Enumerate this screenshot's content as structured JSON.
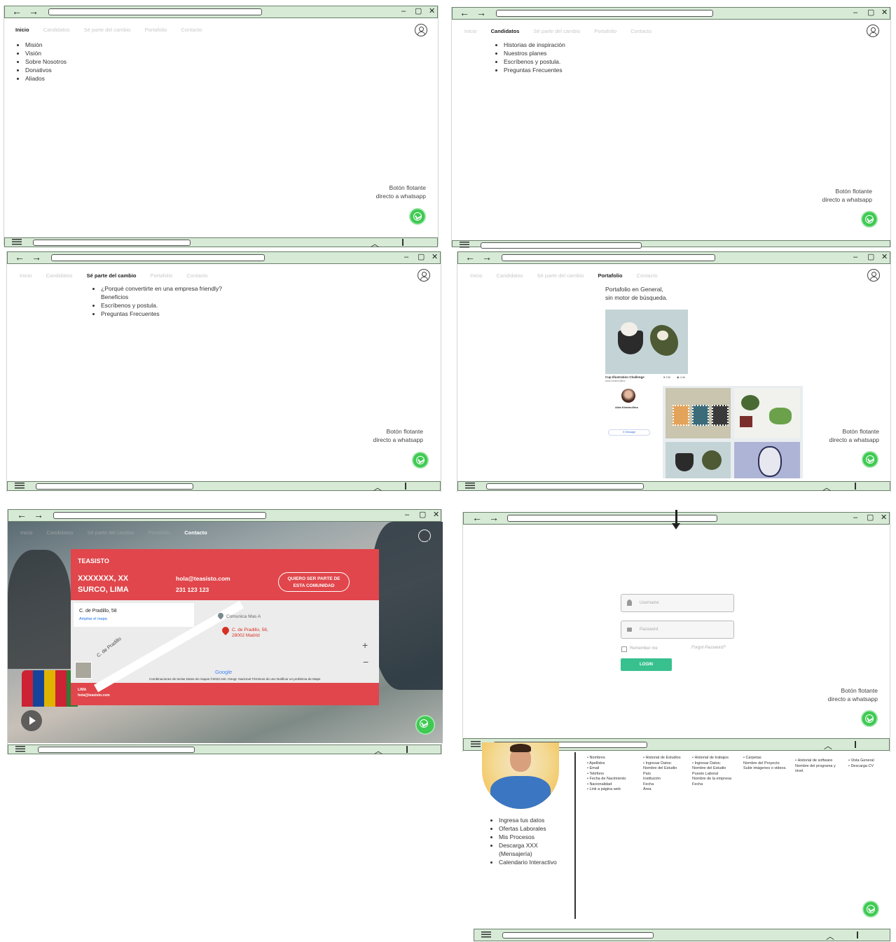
{
  "browser": {
    "back_icon": "←",
    "forward_icon": "→",
    "minimize_icon": "–",
    "maximize_icon": "▢",
    "close_icon": "✕",
    "up_icon": "︿"
  },
  "nav_items": [
    "Inicio",
    "Candidatos",
    "Sé parte del cambio",
    "Portafolio",
    "Contacto"
  ],
  "float_label_1": "Botón flotante",
  "float_label_2": "directo a whatsapp",
  "panel_inicio": {
    "items": [
      "Misión",
      "Visión",
      "Sobre Nosotros",
      "Donativos",
      "Aliados"
    ]
  },
  "panel_candidatos": {
    "items": [
      "Historias de inspiración",
      "Nuestros planes",
      "Escríbenos y postula.",
      "Preguntas Frecuentes"
    ]
  },
  "panel_separte": {
    "items": [
      "¿Porqué convertirte en una empresa friendly?",
      "Escríbenos y postula.",
      "Preguntas Frecuentes"
    ],
    "benefits": "Beneficios"
  },
  "panel_portafolio": {
    "intro_1": "Portafolio en General,",
    "intro_2": "sin motor de búsqueda.",
    "card_title": "Cup Illustration Challenge",
    "card_author": "Aida Khatmullina",
    "card_likes": "♥ 190",
    "card_views": "◉ 4.3k",
    "profile_name": "Aida Khatmullina",
    "message_btn": "✉ Message"
  },
  "panel_contacto": {
    "brand": "TEASISTO",
    "address_1": "XXXXXXX, XX",
    "address_2": "SURCO, LIMA",
    "email": "hola@teasisto.com",
    "phone": "231 123 123",
    "cta_1": "QUIERO SER PARTE DE",
    "cta_2": "ESTA COMUNIDAD",
    "map_place": "C. de Pradillo, 58",
    "map_link": "Ampliar el mapa",
    "map_poi": "Comunica Mas A",
    "map_pin_1": "C. de Pradillo, 58,",
    "map_pin_2": "28002 Madrid",
    "map_street": "C. de Pradillo",
    "map_google": "Google",
    "map_footer": "Combinaciones de teclas   Datos de mapas ©2022 Inst. Geogr. Nacional   Términos de uso   Notificar un problema de Maps",
    "footer_city": "LIMA",
    "footer_email": "hola@teasisto.com",
    "zoom_in": "+",
    "zoom_out": "−"
  },
  "panel_login": {
    "username_placeholder": "Username",
    "password_placeholder": "Password",
    "remember": "Remember me",
    "forgot": "Forgot Password?",
    "login_btn": "LOGIN"
  },
  "panel_profile": {
    "menu": [
      "Ingresa tus datos",
      "Ofertas Laborales",
      "Mis Procesos",
      "Descarga XXX",
      "(Mensajería)",
      "Calendario Interactivo"
    ],
    "col1": [
      "• Nombres",
      "• Apellidos",
      "• Email",
      "• Teléfono",
      "• Fecha de Nacimiento",
      "• Nacionalidad",
      "• Link a página web"
    ],
    "col2": [
      "• Historial de Estudios",
      "• Ingresar Datos:",
      "Nombre del Estudio",
      "País",
      "Institución",
      "Fecha",
      "Área"
    ],
    "col3": [
      "• Historial de trabajos",
      "• Ingresar Datos:",
      "Nombre del Estudio",
      "Puesto Laboral",
      "Nombre de la empresa",
      "Fecha"
    ],
    "col4": [
      "• Carpetas",
      "Nombre del Proyecto",
      "Subir imágenes o videos."
    ],
    "col5": [
      "• Historial de software",
      "Nombre del programa y",
      "nivel."
    ],
    "col6": [
      "• Vista General",
      "• Descarga CV"
    ]
  }
}
